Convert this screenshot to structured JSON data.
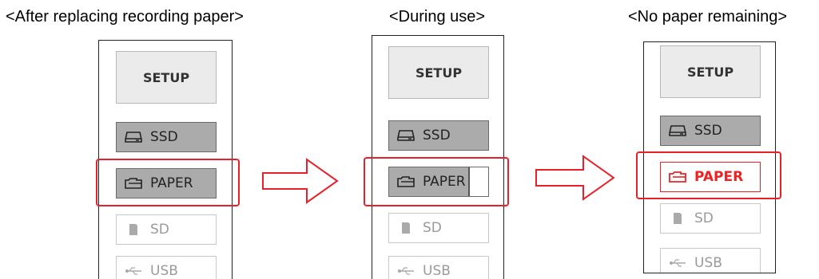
{
  "captions": {
    "left": "<After replacing recording paper>",
    "middle": "<During use>",
    "right": "<No paper remaining>"
  },
  "panels": [
    {
      "state": "after-replacing",
      "setup_label": "SETUP",
      "items": [
        {
          "label": "SSD",
          "icon": "ssd-icon",
          "status": "filled"
        },
        {
          "label": "PAPER",
          "icon": "paper-icon",
          "status": "filled",
          "highlighted": true
        },
        {
          "label": "SD",
          "icon": "sd-card-icon",
          "status": "disabled"
        },
        {
          "label": "USB",
          "icon": "usb-icon",
          "status": "disabled"
        }
      ]
    },
    {
      "state": "during-use",
      "setup_label": "SETUP",
      "items": [
        {
          "label": "SSD",
          "icon": "ssd-icon",
          "status": "filled"
        },
        {
          "label": "PAPER",
          "icon": "paper-icon",
          "status": "partial",
          "fill_fraction": 0.8,
          "highlighted": true
        },
        {
          "label": "SD",
          "icon": "sd-card-icon",
          "status": "disabled"
        },
        {
          "label": "USB",
          "icon": "usb-icon",
          "status": "disabled"
        }
      ]
    },
    {
      "state": "no-paper",
      "setup_label": "SETUP",
      "items": [
        {
          "label": "SSD",
          "icon": "ssd-icon",
          "status": "filled"
        },
        {
          "label": "PAPER",
          "icon": "paper-icon",
          "status": "alert",
          "highlighted": true
        },
        {
          "label": "SD",
          "icon": "sd-card-icon",
          "status": "disabled"
        },
        {
          "label": "USB",
          "icon": "usb-icon",
          "status": "disabled"
        }
      ]
    }
  ],
  "colors": {
    "highlight": "#e8202a",
    "filled": "#ababab",
    "alert": "#ee2222",
    "disabled_text": "#9a9a9a"
  }
}
